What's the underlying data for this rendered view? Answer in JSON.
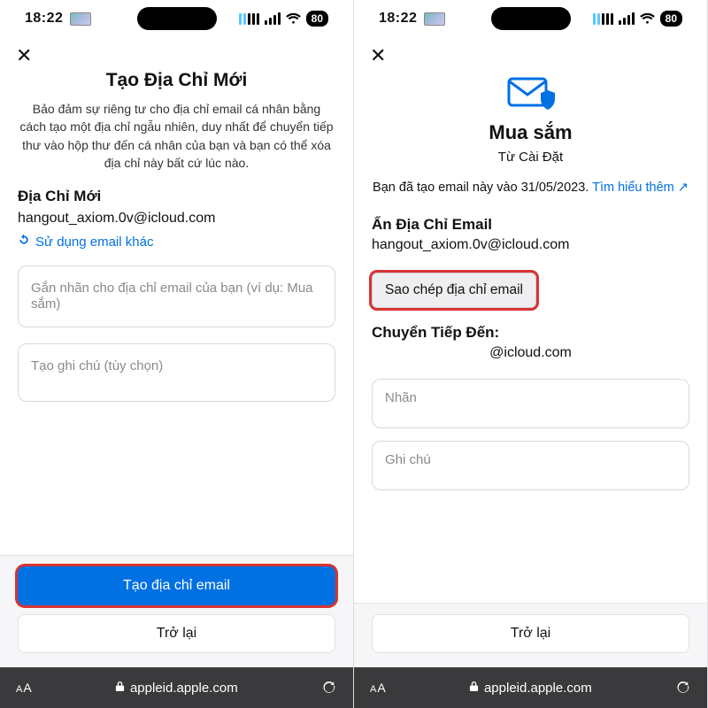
{
  "status": {
    "time": "18:22",
    "battery": "80"
  },
  "safari": {
    "url": "appleid.apple.com",
    "readerLabelSmall": "A",
    "readerLabelLarge": "A"
  },
  "left": {
    "title": "Tạo Địa Chỉ Mới",
    "description": "Bảo đảm sự riêng tư cho địa chỉ email cá nhân bằng cách tạo một địa chỉ ngẫu nhiên, duy nhất để chuyển tiếp thư vào hộp thư đến cá nhân của bạn và bạn có thể xóa địa chỉ này bất cứ lúc nào.",
    "newAddressLabel": "Địa Chỉ Mới",
    "email": "hangout_axiom.0v@icloud.com",
    "useDifferent": "Sử dụng email khác",
    "labelPlaceholder": "Gắn nhãn cho địa chỉ email của bạn (ví dụ: Mua sắm)",
    "notePlaceholder": "Tạo ghi chú (tùy chọn)",
    "createButton": "Tạo địa chỉ email",
    "backButton": "Trở lại"
  },
  "right": {
    "title": "Mua sắm",
    "subtitle": "Từ Cài Đặt",
    "createdPrefix": "Bạn đã tạo email này vào 31/05/2023.",
    "learnMore": "Tìm hiểu thêm ↗",
    "hideEmailLabel": "Ẩn Địa Chỉ Email",
    "email": "hangout_axiom.0v@icloud.com",
    "copyButton": "Sao chép địa chỉ email",
    "forwardLabel": "Chuyển Tiếp Đến:",
    "forwardValue": "@icloud.com",
    "labelPlaceholder": "Nhãn",
    "notePlaceholder": "Ghi chú",
    "backButton": "Trở lại"
  }
}
